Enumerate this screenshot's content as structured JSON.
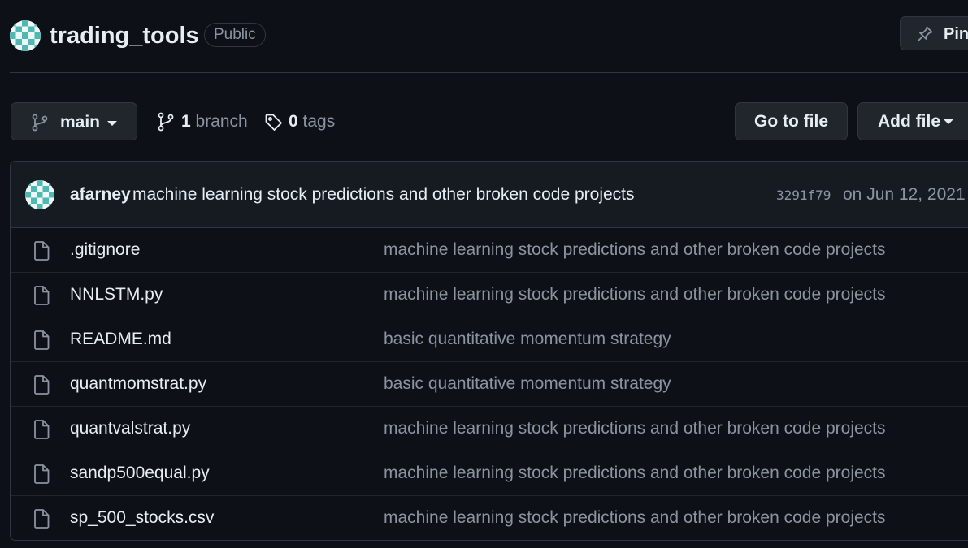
{
  "repo": {
    "name": "trading_tools",
    "visibility": "Public",
    "pin_label": "Pin"
  },
  "toolbar": {
    "branch_name": "main",
    "branch_count": "1",
    "branch_word": "branch",
    "tag_count": "0",
    "tag_word": "tags",
    "goto_file_label": "Go to file",
    "add_file_label": "Add file"
  },
  "latest_commit": {
    "author": "afarney",
    "message": "machine learning stock predictions and other broken code projects",
    "sha": "3291f79",
    "date": "on Jun 12, 2021"
  },
  "files": [
    {
      "name": ".gitignore",
      "commit": "machine learning stock predictions and other broken code projects"
    },
    {
      "name": "NNLSTM.py",
      "commit": "machine learning stock predictions and other broken code projects"
    },
    {
      "name": "README.md",
      "commit": "basic quantitative momentum strategy"
    },
    {
      "name": "quantmomstrat.py",
      "commit": "basic quantitative momentum strategy"
    },
    {
      "name": "quantvalstrat.py",
      "commit": "machine learning stock predictions and other broken code projects"
    },
    {
      "name": "sandp500equal.py",
      "commit": "machine learning stock predictions and other broken code projects"
    },
    {
      "name": "sp_500_stocks.csv",
      "commit": "machine learning stock predictions and other broken code projects"
    }
  ],
  "colors": {
    "background": "#0d1117",
    "surface": "#161b22",
    "button": "#21262d",
    "border": "#30363d",
    "text": "#e6edf3",
    "muted": "#8b949e",
    "avatar_teal": "#4fb8b0"
  },
  "icons": {
    "pin": "pin-icon",
    "branch": "git-branch-icon",
    "tag": "tag-icon",
    "file": "file-icon",
    "caret": "caret-down-icon"
  }
}
